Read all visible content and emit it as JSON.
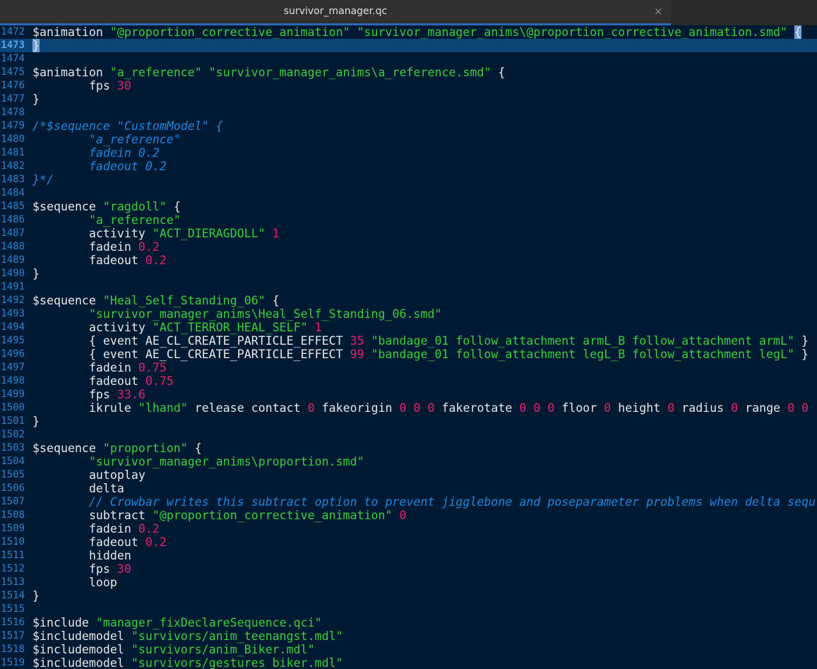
{
  "tab": {
    "title": "survivor_manager.qc",
    "close_icon": "×"
  },
  "editor": {
    "current_line": 1473,
    "lines": [
      {
        "n": "1472",
        "tokens": [
          [
            "p",
            "$animation "
          ],
          [
            "s",
            "\"@proportion_corrective_animation\" \"survivor_manager_anims\\@proportion_corrective_animation.smd\""
          ],
          [
            "p",
            " "
          ],
          [
            "b",
            "{"
          ]
        ]
      },
      {
        "n": "1473",
        "tokens": [
          [
            "b",
            "}"
          ]
        ]
      },
      {
        "n": "1474",
        "tokens": []
      },
      {
        "n": "1475",
        "tokens": [
          [
            "p",
            "$animation "
          ],
          [
            "s",
            "\"a_reference\" \"survivor_manager_anims\\a_reference.smd\""
          ],
          [
            "p",
            " {"
          ]
        ]
      },
      {
        "n": "1476",
        "tokens": [
          [
            "p",
            "\tfps "
          ],
          [
            "n",
            "30"
          ]
        ]
      },
      {
        "n": "1477",
        "tokens": [
          [
            "p",
            "}"
          ]
        ]
      },
      {
        "n": "1478",
        "tokens": []
      },
      {
        "n": "1479",
        "tokens": [
          [
            "c",
            "/*$sequence \"CustomModel\" {"
          ]
        ]
      },
      {
        "n": "1480",
        "tokens": [
          [
            "c",
            "\t\"a_reference\""
          ]
        ]
      },
      {
        "n": "1481",
        "tokens": [
          [
            "c",
            "\tfadein 0.2"
          ]
        ]
      },
      {
        "n": "1482",
        "tokens": [
          [
            "c",
            "\tfadeout 0.2"
          ]
        ]
      },
      {
        "n": "1483",
        "tokens": [
          [
            "c",
            "}*/"
          ]
        ]
      },
      {
        "n": "1484",
        "tokens": []
      },
      {
        "n": "1485",
        "tokens": [
          [
            "p",
            "$sequence "
          ],
          [
            "s",
            "\"ragdoll\""
          ],
          [
            "p",
            " {"
          ]
        ]
      },
      {
        "n": "1486",
        "tokens": [
          [
            "p",
            "\t"
          ],
          [
            "s",
            "\"a_reference\""
          ]
        ]
      },
      {
        "n": "1487",
        "tokens": [
          [
            "p",
            "\tactivity "
          ],
          [
            "s",
            "\"ACT_DIERAGDOLL\""
          ],
          [
            "p",
            " "
          ],
          [
            "n",
            "1"
          ]
        ]
      },
      {
        "n": "1488",
        "tokens": [
          [
            "p",
            "\tfadein "
          ],
          [
            "n",
            "0.2"
          ]
        ]
      },
      {
        "n": "1489",
        "tokens": [
          [
            "p",
            "\tfadeout "
          ],
          [
            "n",
            "0.2"
          ]
        ]
      },
      {
        "n": "1490",
        "tokens": [
          [
            "p",
            "}"
          ]
        ]
      },
      {
        "n": "1491",
        "tokens": []
      },
      {
        "n": "1492",
        "tokens": [
          [
            "p",
            "$sequence "
          ],
          [
            "s",
            "\"Heal_Self_Standing_06\""
          ],
          [
            "p",
            " {"
          ]
        ]
      },
      {
        "n": "1493",
        "tokens": [
          [
            "p",
            "\t"
          ],
          [
            "s",
            "\"survivor_manager_anims\\Heal_Self_Standing_06.smd\""
          ]
        ]
      },
      {
        "n": "1494",
        "tokens": [
          [
            "p",
            "\tactivity "
          ],
          [
            "s",
            "\"ACT_TERROR_HEAL_SELF\""
          ],
          [
            "p",
            " "
          ],
          [
            "n",
            "1"
          ]
        ]
      },
      {
        "n": "1495",
        "tokens": [
          [
            "p",
            "\t{ event AE_CL_CREATE_PARTICLE_EFFECT "
          ],
          [
            "n",
            "35"
          ],
          [
            "p",
            " "
          ],
          [
            "s",
            "\"bandage_01 follow_attachment armL_B follow_attachment armL\""
          ],
          [
            "p",
            " }"
          ]
        ]
      },
      {
        "n": "1496",
        "tokens": [
          [
            "p",
            "\t{ event AE_CL_CREATE_PARTICLE_EFFECT "
          ],
          [
            "n",
            "99"
          ],
          [
            "p",
            " "
          ],
          [
            "s",
            "\"bandage_01 follow_attachment legL_B follow_attachment legL\""
          ],
          [
            "p",
            " }"
          ]
        ]
      },
      {
        "n": "1497",
        "tokens": [
          [
            "p",
            "\tfadein "
          ],
          [
            "n",
            "0.75"
          ]
        ]
      },
      {
        "n": "1498",
        "tokens": [
          [
            "p",
            "\tfadeout "
          ],
          [
            "n",
            "0.75"
          ]
        ]
      },
      {
        "n": "1499",
        "tokens": [
          [
            "p",
            "\tfps "
          ],
          [
            "n",
            "33.6"
          ]
        ]
      },
      {
        "n": "1500",
        "tokens": [
          [
            "p",
            "\tikrule "
          ],
          [
            "s",
            "\"lhand\""
          ],
          [
            "p",
            " release contact "
          ],
          [
            "n",
            "0"
          ],
          [
            "p",
            " fakeorigin "
          ],
          [
            "n",
            "0 0 0"
          ],
          [
            "p",
            " fakerotate "
          ],
          [
            "n",
            "0 0 0"
          ],
          [
            "p",
            " floor "
          ],
          [
            "n",
            "0"
          ],
          [
            "p",
            " height "
          ],
          [
            "n",
            "0"
          ],
          [
            "p",
            " radius "
          ],
          [
            "n",
            "0"
          ],
          [
            "p",
            " range "
          ],
          [
            "n",
            "0 0"
          ]
        ]
      },
      {
        "n": "1501",
        "tokens": [
          [
            "p",
            "}"
          ]
        ]
      },
      {
        "n": "1502",
        "tokens": []
      },
      {
        "n": "1503",
        "tokens": [
          [
            "p",
            "$sequence "
          ],
          [
            "s",
            "\"proportion\""
          ],
          [
            "p",
            " {"
          ]
        ]
      },
      {
        "n": "1504",
        "tokens": [
          [
            "p",
            "\t"
          ],
          [
            "s",
            "\"survivor_manager_anims\\proportion.smd\""
          ]
        ]
      },
      {
        "n": "1505",
        "tokens": [
          [
            "p",
            "\tautoplay"
          ]
        ]
      },
      {
        "n": "1506",
        "tokens": [
          [
            "p",
            "\tdelta"
          ]
        ]
      },
      {
        "n": "1507",
        "tokens": [
          [
            "p",
            "\t"
          ],
          [
            "c",
            "// Crowbar writes this subtract option to prevent jigglebone and poseparameter problems when delta sequ"
          ]
        ]
      },
      {
        "n": "1508",
        "tokens": [
          [
            "p",
            "\tsubtract "
          ],
          [
            "s",
            "\"@proportion_corrective_animation\""
          ],
          [
            "p",
            " "
          ],
          [
            "n",
            "0"
          ]
        ]
      },
      {
        "n": "1509",
        "tokens": [
          [
            "p",
            "\tfadein "
          ],
          [
            "n",
            "0.2"
          ]
        ]
      },
      {
        "n": "1510",
        "tokens": [
          [
            "p",
            "\tfadeout "
          ],
          [
            "n",
            "0.2"
          ]
        ]
      },
      {
        "n": "1511",
        "tokens": [
          [
            "p",
            "\thidden"
          ]
        ]
      },
      {
        "n": "1512",
        "tokens": [
          [
            "p",
            "\tfps "
          ],
          [
            "n",
            "30"
          ]
        ]
      },
      {
        "n": "1513",
        "tokens": [
          [
            "p",
            "\tloop"
          ]
        ]
      },
      {
        "n": "1514",
        "tokens": [
          [
            "p",
            "}"
          ]
        ]
      },
      {
        "n": "1515",
        "tokens": []
      },
      {
        "n": "1516",
        "tokens": [
          [
            "p",
            "$include "
          ],
          [
            "s",
            "\"manager_fixDeclareSequence.qci\""
          ]
        ]
      },
      {
        "n": "1517",
        "tokens": [
          [
            "p",
            "$includemodel "
          ],
          [
            "s",
            "\"survivors/anim_teenangst.mdl\""
          ]
        ]
      },
      {
        "n": "1518",
        "tokens": [
          [
            "p",
            "$includemodel "
          ],
          [
            "s",
            "\"survivors/anim_Biker.mdl\""
          ]
        ]
      },
      {
        "n": "1519",
        "tokens": [
          [
            "p",
            "$includemodel "
          ],
          [
            "s",
            "\"survivors/gestures_biker.mdl\""
          ]
        ]
      }
    ]
  }
}
